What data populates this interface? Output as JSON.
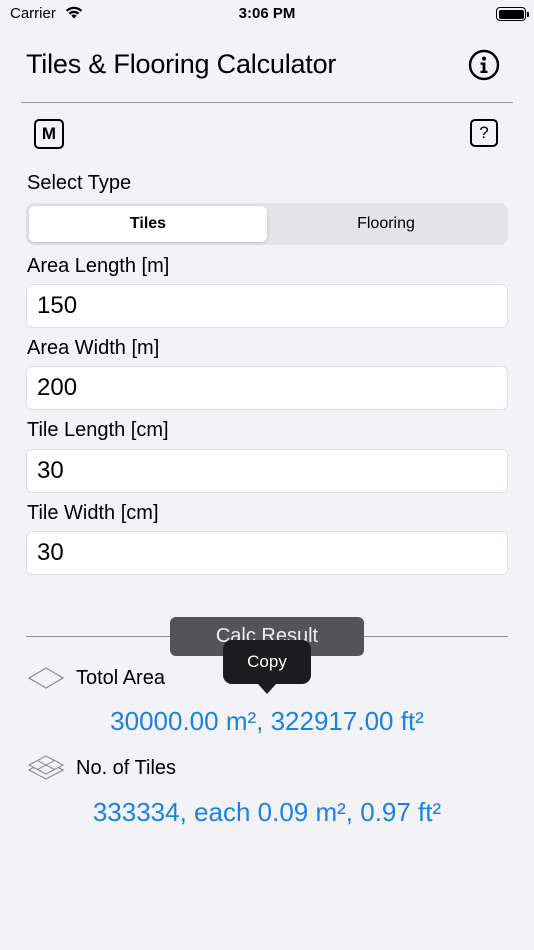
{
  "status_bar": {
    "carrier": "Carrier",
    "time": "3:06 PM"
  },
  "header": {
    "title": "Tiles & Flooring Calculator"
  },
  "toolbar": {
    "m_label": "M",
    "help_label": "?"
  },
  "select_type": {
    "label": "Select Type",
    "options": [
      "Tiles",
      "Flooring"
    ],
    "selected": "Tiles"
  },
  "fields": {
    "area_length": {
      "label": "Area Length [m]",
      "value": "150"
    },
    "area_width": {
      "label": "Area Width [m]",
      "value": "200"
    },
    "tile_length": {
      "label": "Tile Length [cm]",
      "value": "30"
    },
    "tile_width": {
      "label": "Tile Width [cm]",
      "value": "30"
    }
  },
  "calc_button": {
    "label": "Calc Result"
  },
  "tooltip": {
    "label": "Copy"
  },
  "results": {
    "total_area": {
      "label": "Totol Area",
      "value": "30000.00 m², 322917.00 ft²"
    },
    "tiles": {
      "label": "No. of Tiles",
      "value": "333334, each 0.09 m², 0.97 ft²"
    }
  },
  "colors": {
    "accent": "#1a82e2",
    "background": "#f2f2f7"
  }
}
